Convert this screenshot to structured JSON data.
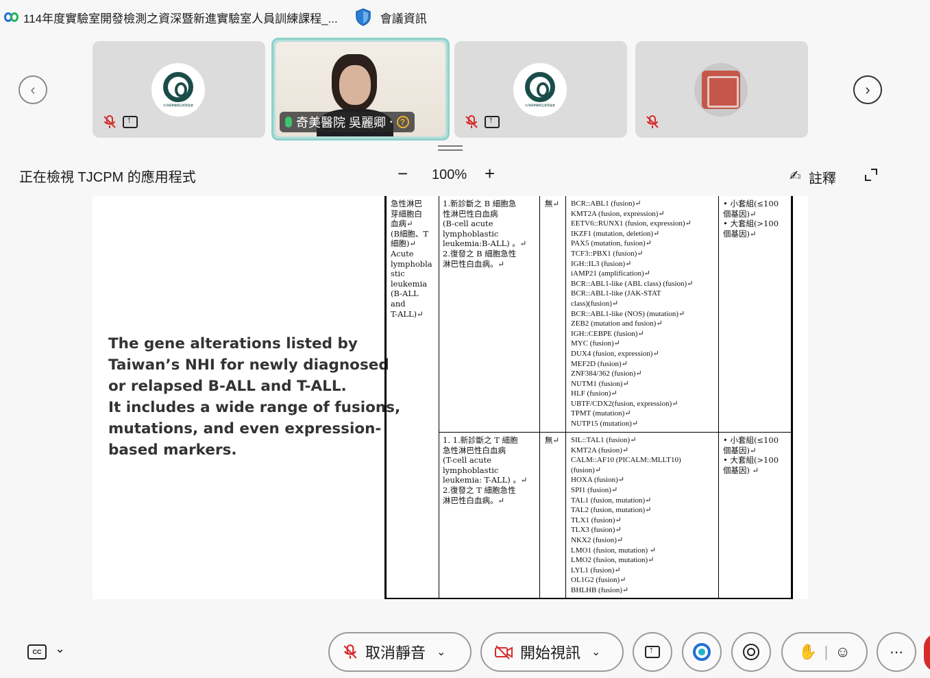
{
  "window": {
    "title": "114年度實驗室開發檢測之資深暨新進實驗室人員訓練課程_...",
    "meeting_info": "會議資訊"
  },
  "participants": [
    {
      "name": "",
      "avatar": "logo",
      "muted": true,
      "sharing": true
    },
    {
      "name": "奇美醫院 吳麗卿",
      "avatar": "video",
      "muted": false,
      "active_speaker": true
    },
    {
      "name": "",
      "avatar": "logo",
      "muted": true,
      "sharing": true
    },
    {
      "name": "",
      "avatar": "seal",
      "muted": true,
      "sharing": false
    }
  ],
  "share": {
    "label": "正在檢視 TJCPM 的應用程式",
    "zoom_out": "−",
    "zoom": "100%",
    "zoom_in": "+",
    "annotate": "註釋"
  },
  "slide": {
    "caption": [
      "The gene alterations listed by",
      "Taiwan’s NHI for newly diagnosed",
      "or relapsed B-ALL and T-ALL.",
      "It includes a wide range of fusions,",
      "mutations, and even expression-",
      "based markers."
    ],
    "table": {
      "disease": [
        "急性淋巴",
        "芽細胞白",
        "血病↵",
        "(B細胞、T",
        "細胞)↵",
        "Acute",
        "lymphobla",
        "stic",
        "leukemia",
        "(B-ALL",
        "and",
        "T-ALL)↵"
      ],
      "rows": [
        {
          "indication": [
            "1.新診斷之 B 細胞急",
            "   性淋巴性白血病",
            "   (B-cell acute",
            "   lymphoblastic",
            "   leukemia:B-ALL) 。↵",
            "2.復發之 B 細胞急性",
            "   淋巴性白血病。↵"
          ],
          "none": "無↵",
          "genes": [
            "BCR::ABL1 (fusion)↵",
            "KMT2A (fusion, expression)↵",
            "EETV6::RUNX1 (fusion, expression)↵",
            "IKZF1 (mutation, deletion)↵",
            "PAX5 (mutation, fusion)↵",
            "TCF3::PBX1 (fusion)↵",
            "IGH::IL3 (fusion)↵",
            "iAMP21 (amplification)↵",
            "BCR::ABL1-like (ABL class) (fusion)↵",
            "BCR::ABL1-like (JAK-STAT",
            "class)(fusion)↵",
            "BCR::ABL1-like (NOS) (mutation)↵",
            "ZEB2 (mutation and fusion)↵",
            "IGH::CEBPE (fusion)↵",
            "MYC (fusion)↵",
            "DUX4 (fusion, expression)↵",
            "MEF2D (fusion)↵",
            "ZNF384/362 (fusion)↵",
            "NUTM1 (fusion)↵",
            "HLF (fusion)↵",
            "UBTF/CDX2(fusion, expression)↵",
            "TPMT (mutation)↵",
            "NUTP15 (mutation)↵"
          ],
          "panel": [
            "• 小套組(≤100",
            "  個基因)↵",
            "• 大套組(>100",
            "  個基因)↵"
          ]
        },
        {
          "indication": [
            "1. 1.新診斷之 T 細胞",
            "   急性淋巴性白血病",
            "   (T-cell acute",
            "   lymphoblastic",
            "   leukemia: T-ALL) 。↵",
            "2.復發之 T 細胞急性",
            "   淋巴性白血病。↵"
          ],
          "none": "無↵",
          "genes": [
            "SIL::TAL1 (fusion)↵",
            "KMT2A (fusion)↵",
            "CALM::AF10 (PICALM::MLLT10)",
            "(fusion)↵",
            "HOXA (fusion)↵",
            "SPI1 (fusion)↵",
            "TAL1 (fusion, mutation)↵",
            "TAL2 (fusion, mutation)↵",
            "TLX1 (fusion)↵",
            "TLX3 (fusion)↵",
            "NKX2 (fusion)↵",
            "LMO1 (fusion, mutation) ↵",
            "LMO2 (fusion, mutation)↵",
            "LYL1 (fusion)↵",
            "OL1G2 (fusion)↵",
            "BHLHB (fusion)↵"
          ],
          "panel": [
            "• 小套組(≤100",
            "  個基因)↵",
            "• 大套組(>100",
            "  個基因) ↵"
          ]
        }
      ]
    }
  },
  "toolbar": {
    "unmute": "取消靜音",
    "start_video": "開始視訊"
  },
  "colors": {
    "accent_active": "#8ed1c9",
    "mute_red": "#d62b2b"
  }
}
